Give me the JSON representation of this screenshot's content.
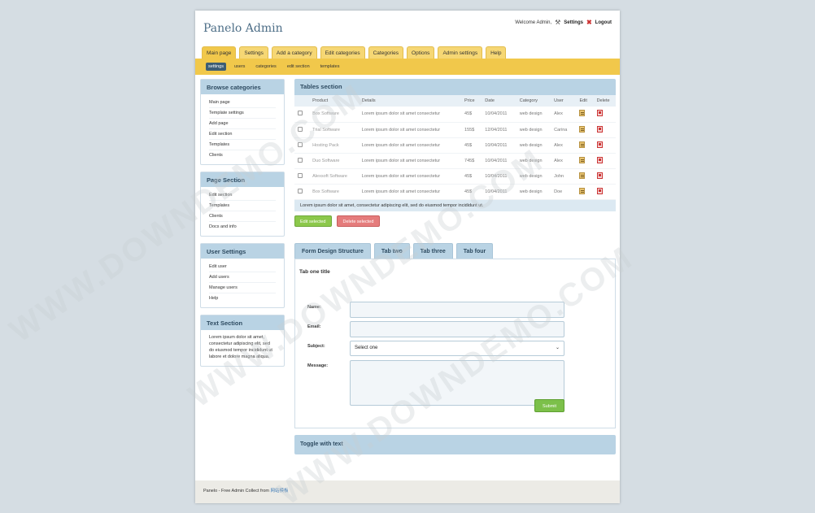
{
  "header": {
    "logo": "Panelo Admin",
    "welcome": "Welcome Admin,",
    "settings": "Settings",
    "logout": "Logout"
  },
  "nav": {
    "tabs": [
      "Main page",
      "Settings",
      "Add a category",
      "Edit categories",
      "Categories",
      "Options",
      "Admin settings",
      "Help"
    ],
    "subtabs": [
      "settings",
      "users",
      "categories",
      "edit section",
      "templates"
    ]
  },
  "sidebar": {
    "browse": {
      "title": "Browse categories",
      "items": [
        "Main page",
        "Template settings",
        "Add page",
        "Edit section",
        "Templates",
        "Clients"
      ]
    },
    "page": {
      "title": "Page Section",
      "items": [
        "Edit section",
        "Templates",
        "Clients",
        "Docs and info"
      ]
    },
    "user": {
      "title": "User Settings",
      "items": [
        "Edit user",
        "Add users",
        "Manage users",
        "Help"
      ]
    },
    "text": {
      "title": "Text Section",
      "body": "Lorem ipsum dolor sit amet, consectetur adipiscing elit, sed do eiusmod tempor incididunt ut labore et dolore magna aliqua."
    }
  },
  "table": {
    "title": "Tables section",
    "columns": [
      "Product",
      "Details",
      "Price",
      "Date",
      "Category",
      "User",
      "Edit",
      "Delete"
    ],
    "rows": [
      {
        "product": "Box Software",
        "details": "Lorem ipsum dolor sit amet consectetur",
        "price": "45$",
        "date": "10/04/2011",
        "category": "web design",
        "user": "Alex"
      },
      {
        "product": "Trial Software",
        "details": "Lorem ipsum dolor sit amet consectetur",
        "price": "155$",
        "date": "12/04/2011",
        "category": "web design",
        "user": "Carina"
      },
      {
        "product": "Hosting Pack",
        "details": "Lorem ipsum dolor sit amet consectetur",
        "price": "45$",
        "date": "10/04/2011",
        "category": "web design",
        "user": "Alex"
      },
      {
        "product": "Duo Software",
        "details": "Lorem ipsum dolor sit amet consectetur",
        "price": "745$",
        "date": "10/04/2011",
        "category": "web design",
        "user": "Alex"
      },
      {
        "product": "Alexsoft Software",
        "details": "Lorem ipsum dolor sit amet consectetur",
        "price": "45$",
        "date": "10/04/2011",
        "category": "web design",
        "user": "John"
      },
      {
        "product": "Box Software",
        "details": "Lorem ipsum dolor sit amet consectetur",
        "price": "45$",
        "date": "10/04/2011",
        "category": "web design",
        "user": "Doe"
      }
    ],
    "footer": "Lorem ipsum dolor sit amet, consectetur adipiscing elit, sed do eiusmod tempor incididunt ut.",
    "edit_selected": "Edit selected",
    "delete_selected": "Delete selected"
  },
  "form": {
    "tabs": [
      "Form Design Structure",
      "Tab two",
      "Tab three",
      "Tab four"
    ],
    "title": "Tab one title",
    "name_label": "Name:",
    "email_label": "Email:",
    "subject_label": "Subject:",
    "subject_value": "Select one",
    "message_label": "Message:",
    "submit": "Submit"
  },
  "toggle": "Toggle with text",
  "footer": {
    "text": "Panelo - Free Admin Collect from",
    "link": "网站模板"
  },
  "watermark": "WWW.DOWNDEMO.COM"
}
